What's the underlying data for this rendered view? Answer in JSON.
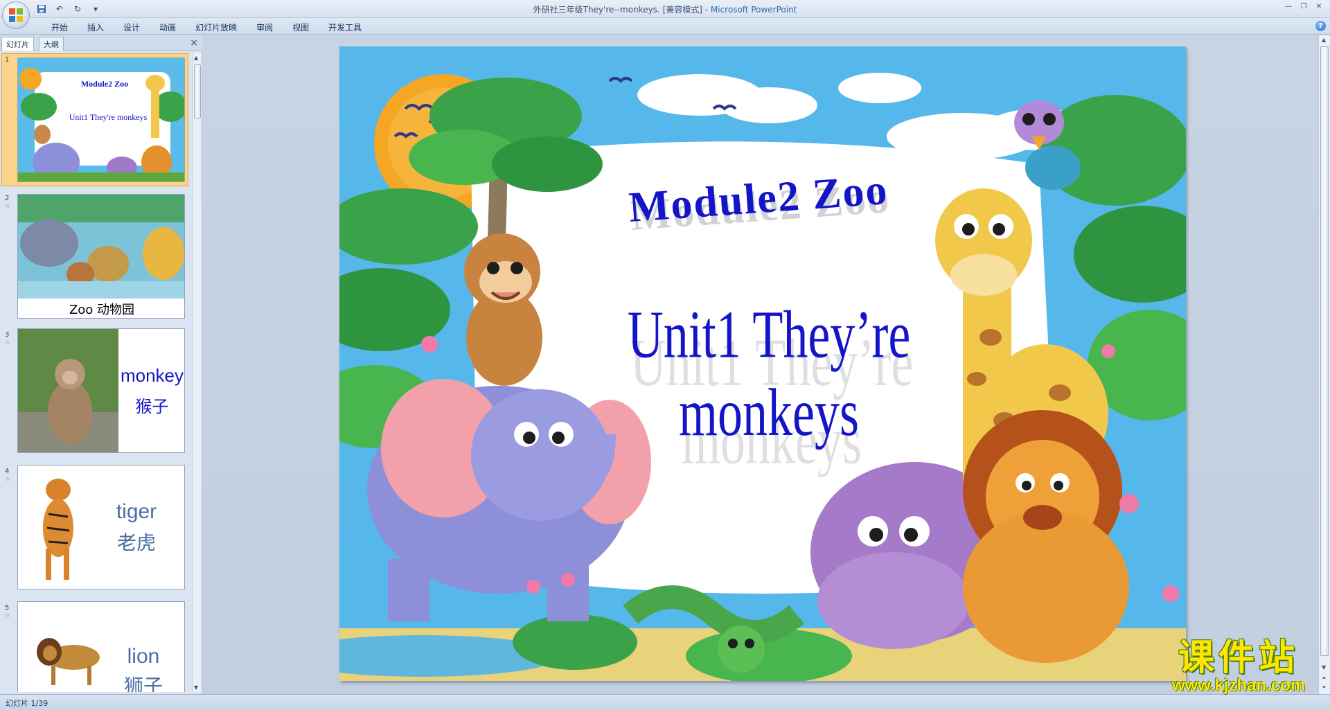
{
  "window": {
    "title": "外研社三年级They're--monkeys. [兼容模式] - ",
    "app_name": "Microsoft PowerPoint"
  },
  "ribbon": {
    "tabs": [
      "开始",
      "插入",
      "设计",
      "动画",
      "幻灯片放映",
      "审阅",
      "视图",
      "开发工具"
    ]
  },
  "panel": {
    "tab_slides": "幻灯片",
    "tab_outline": "大纲",
    "close": "×"
  },
  "thumbnails": [
    {
      "number": "1",
      "title": "Module2 Zoo",
      "subtitle": "Unit1 They're monkeys"
    },
    {
      "number": "2",
      "caption": "Zoo 动物园"
    },
    {
      "number": "3",
      "word": "monkey",
      "cn": "猴子"
    },
    {
      "number": "4",
      "word": "tiger",
      "cn": "老虎"
    },
    {
      "number": "5",
      "word": "lion",
      "cn": "狮子"
    }
  ],
  "slide": {
    "title": "Module2 Zoo",
    "subtitle": "Unit1 They’re monkeys"
  },
  "status": {
    "slide_indicator": "幻灯片 1/39"
  },
  "watermark": {
    "cn": "课件站",
    "url": "www.kjzhan.com"
  },
  "colors": {
    "title_blue": "#1414c8",
    "sky": "#56b7ea",
    "leaf_green": "#3aa34a",
    "ribbon_bg": "#dfe8f3",
    "selection": "#f5a63b"
  }
}
